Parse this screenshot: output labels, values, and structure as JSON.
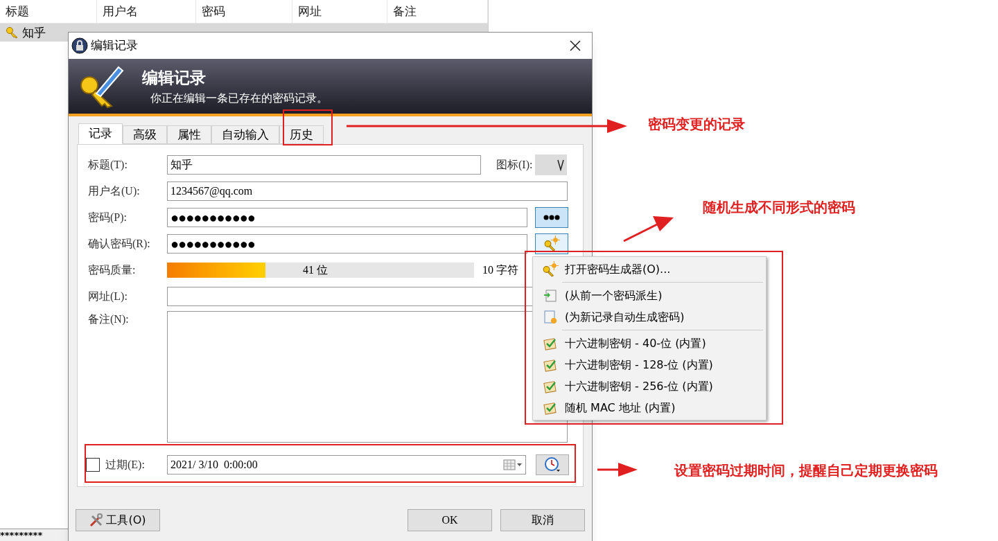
{
  "list": {
    "columns": [
      "标题",
      "用户名",
      "密码",
      "网址",
      "备注"
    ],
    "rows": [
      {
        "cells": [
          "知乎"
        ],
        "selected": true
      }
    ],
    "status_bar": "*********"
  },
  "dialog": {
    "title": "编辑记录",
    "banner": {
      "title": "编辑记录",
      "subtitle": "你正在编辑一条已存在的密码记录。"
    },
    "tabs": [
      {
        "label": "记录",
        "selected": true
      },
      {
        "label": "高级",
        "selected": false
      },
      {
        "label": "属性",
        "selected": false
      },
      {
        "label": "自动输入",
        "selected": false
      },
      {
        "label": "历史",
        "selected": false
      }
    ],
    "title_field": {
      "label": "标题(T):",
      "value": "知乎"
    },
    "icon_label": "图标(I):",
    "username": {
      "label": "用户名(U):",
      "value": "1234567@qq.com"
    },
    "password": {
      "label": "密码(P):",
      "value": "●●●●●●●●●●●"
    },
    "repeat": {
      "label": "确认密码(R):",
      "value": "●●●●●●●●●●●"
    },
    "quality": {
      "label": "密码质量:",
      "level": 0.32,
      "reading": "41 位",
      "chars": "10 字符"
    },
    "url": {
      "label": "网址(L):"
    },
    "notes": {
      "label": "备注(N):"
    },
    "expiry": {
      "label": "过期(E):",
      "checked": false,
      "value": "2021/ 3/10  0:00:00"
    },
    "buttons": {
      "tools": "工具(O)",
      "ok": "OK",
      "cancel": "取消"
    }
  },
  "menu": [
    {
      "kind": "generator",
      "label": "打开密码生成器(O)..."
    },
    {
      "kind": "separator"
    },
    {
      "kind": "derive",
      "label": "(从前一个密码派生)"
    },
    {
      "kind": "autogen",
      "label": "(为新记录自动生成密码)"
    },
    {
      "kind": "separator"
    },
    {
      "kind": "builtin",
      "label": "十六进制密钥 - 40-位 (内置)"
    },
    {
      "kind": "builtin",
      "label": "十六进制密钥 - 128-位 (内置)"
    },
    {
      "kind": "builtin",
      "label": "十六进制密钥 - 256-位 (内置)"
    },
    {
      "kind": "builtin",
      "label": "随机 MAC 地址 (内置)"
    }
  ],
  "annotations": [
    "密码变更的记录",
    "随机生成不同形式的密码",
    "设置密码过期时间，提醒自己定期更换密码"
  ]
}
